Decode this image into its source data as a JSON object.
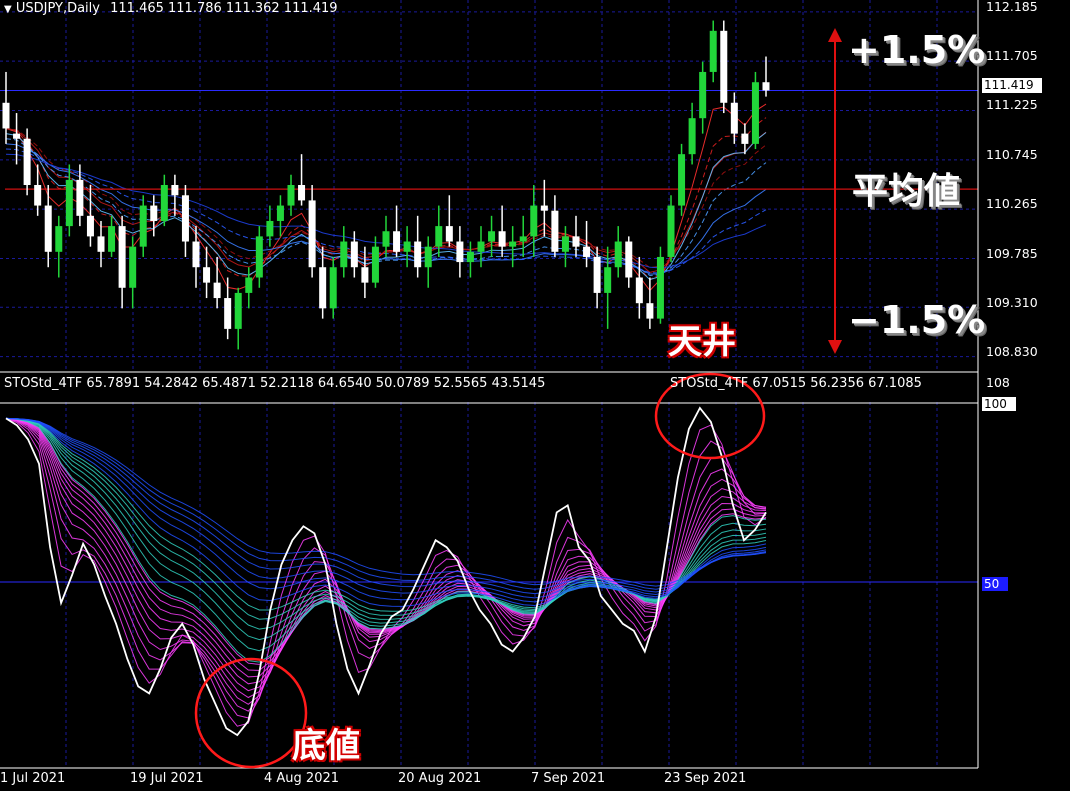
{
  "header": {
    "symbol_label": "USDJPY,Daily",
    "ohlc": "111.465 111.786 111.362 111.419"
  },
  "indicator": {
    "label": "STOStd_4TF 65.7891 54.2842 65.4871 52.2118 64.6540 50.0789 52.5565 43.5145",
    "label2": "STOStd_4TF 67.0515 56.2356 67.1085",
    "scale_top": "108",
    "level_100": "100",
    "level_50": "50"
  },
  "price_scale": [
    "112.185",
    "111.705",
    "111.225",
    "110.745",
    "110.265",
    "109.785",
    "109.310",
    "108.830"
  ],
  "current_price": "111.419",
  "annotations": {
    "plus": "+1.5%",
    "mean": "平均値",
    "minus": "−1.5%",
    "top": "天井",
    "bottom": "底値"
  },
  "colors": {
    "bull": "#22d63a",
    "bear": "#ffffff",
    "grid": "#1a1a9c",
    "mean_line": "#d01010",
    "stoch_main": "#ffffff",
    "stoch_fast": "#ff40ff",
    "stoch_mid": "#30d0c0",
    "stoch_slow": "#2050ff",
    "circle": "#ff1a1a"
  },
  "chart_data": {
    "type": "line",
    "x_labels": [
      "1 Jul 2021",
      "19 Jul 2021",
      "4 Aug 2021",
      "20 Aug 2021",
      "7 Sep 2021",
      "23 Sep 2021"
    ],
    "price_ylim": [
      108.7,
      112.3
    ],
    "mean_price": 110.46,
    "candles": [
      {
        "o": 111.3,
        "h": 111.6,
        "l": 110.9,
        "c": 111.05
      },
      {
        "o": 111.0,
        "h": 111.2,
        "l": 110.7,
        "c": 110.95
      },
      {
        "o": 110.95,
        "h": 111.05,
        "l": 110.4,
        "c": 110.5
      },
      {
        "o": 110.5,
        "h": 110.7,
        "l": 110.2,
        "c": 110.3
      },
      {
        "o": 110.3,
        "h": 110.5,
        "l": 109.7,
        "c": 109.85
      },
      {
        "o": 109.85,
        "h": 110.2,
        "l": 109.6,
        "c": 110.1
      },
      {
        "o": 110.1,
        "h": 110.7,
        "l": 110.0,
        "c": 110.55
      },
      {
        "o": 110.55,
        "h": 110.7,
        "l": 110.1,
        "c": 110.2
      },
      {
        "o": 110.2,
        "h": 110.5,
        "l": 109.9,
        "c": 110.0
      },
      {
        "o": 110.0,
        "h": 110.15,
        "l": 109.7,
        "c": 109.85
      },
      {
        "o": 109.85,
        "h": 110.2,
        "l": 109.8,
        "c": 110.1
      },
      {
        "o": 110.1,
        "h": 110.2,
        "l": 109.3,
        "c": 109.5
      },
      {
        "o": 109.5,
        "h": 110.0,
        "l": 109.3,
        "c": 109.9
      },
      {
        "o": 109.9,
        "h": 110.4,
        "l": 109.8,
        "c": 110.3
      },
      {
        "o": 110.3,
        "h": 110.4,
        "l": 110.0,
        "c": 110.15
      },
      {
        "o": 110.15,
        "h": 110.6,
        "l": 110.1,
        "c": 110.5
      },
      {
        "o": 110.5,
        "h": 110.6,
        "l": 110.2,
        "c": 110.4
      },
      {
        "o": 110.4,
        "h": 110.5,
        "l": 109.8,
        "c": 109.95
      },
      {
        "o": 109.95,
        "h": 110.1,
        "l": 109.5,
        "c": 109.7
      },
      {
        "o": 109.7,
        "h": 109.9,
        "l": 109.4,
        "c": 109.55
      },
      {
        "o": 109.55,
        "h": 109.8,
        "l": 109.3,
        "c": 109.4
      },
      {
        "o": 109.4,
        "h": 109.6,
        "l": 109.0,
        "c": 109.1
      },
      {
        "o": 109.1,
        "h": 109.5,
        "l": 108.9,
        "c": 109.45
      },
      {
        "o": 109.45,
        "h": 109.7,
        "l": 109.3,
        "c": 109.6
      },
      {
        "o": 109.6,
        "h": 110.1,
        "l": 109.5,
        "c": 110.0
      },
      {
        "o": 110.0,
        "h": 110.3,
        "l": 109.9,
        "c": 110.15
      },
      {
        "o": 110.15,
        "h": 110.4,
        "l": 110.0,
        "c": 110.3
      },
      {
        "o": 110.3,
        "h": 110.6,
        "l": 110.2,
        "c": 110.5
      },
      {
        "o": 110.5,
        "h": 110.8,
        "l": 110.3,
        "c": 110.35
      },
      {
        "o": 110.35,
        "h": 110.5,
        "l": 109.6,
        "c": 109.7
      },
      {
        "o": 109.7,
        "h": 109.9,
        "l": 109.2,
        "c": 109.3
      },
      {
        "o": 109.3,
        "h": 109.8,
        "l": 109.2,
        "c": 109.7
      },
      {
        "o": 109.7,
        "h": 110.1,
        "l": 109.6,
        "c": 109.95
      },
      {
        "o": 109.95,
        "h": 110.05,
        "l": 109.6,
        "c": 109.7
      },
      {
        "o": 109.7,
        "h": 109.9,
        "l": 109.4,
        "c": 109.55
      },
      {
        "o": 109.55,
        "h": 110.0,
        "l": 109.5,
        "c": 109.9
      },
      {
        "o": 109.9,
        "h": 110.2,
        "l": 109.8,
        "c": 110.05
      },
      {
        "o": 110.05,
        "h": 110.3,
        "l": 109.8,
        "c": 109.85
      },
      {
        "o": 109.85,
        "h": 110.1,
        "l": 109.7,
        "c": 109.95
      },
      {
        "o": 109.95,
        "h": 110.2,
        "l": 109.6,
        "c": 109.7
      },
      {
        "o": 109.7,
        "h": 110.0,
        "l": 109.5,
        "c": 109.9
      },
      {
        "o": 109.9,
        "h": 110.3,
        "l": 109.8,
        "c": 110.1
      },
      {
        "o": 110.1,
        "h": 110.4,
        "l": 109.9,
        "c": 109.95
      },
      {
        "o": 109.95,
        "h": 110.1,
        "l": 109.6,
        "c": 109.75
      },
      {
        "o": 109.75,
        "h": 109.95,
        "l": 109.6,
        "c": 109.85
      },
      {
        "o": 109.85,
        "h": 110.1,
        "l": 109.7,
        "c": 109.95
      },
      {
        "o": 109.95,
        "h": 110.2,
        "l": 109.8,
        "c": 110.05
      },
      {
        "o": 110.05,
        "h": 110.3,
        "l": 109.8,
        "c": 109.9
      },
      {
        "o": 109.9,
        "h": 110.1,
        "l": 109.7,
        "c": 109.95
      },
      {
        "o": 109.95,
        "h": 110.2,
        "l": 109.8,
        "c": 110.0
      },
      {
        "o": 110.0,
        "h": 110.5,
        "l": 109.8,
        "c": 110.3
      },
      {
        "o": 110.3,
        "h": 110.55,
        "l": 110.0,
        "c": 110.25
      },
      {
        "o": 110.25,
        "h": 110.4,
        "l": 109.8,
        "c": 109.85
      },
      {
        "o": 109.85,
        "h": 110.1,
        "l": 109.7,
        "c": 110.0
      },
      {
        "o": 110.0,
        "h": 110.2,
        "l": 109.8,
        "c": 109.9
      },
      {
        "o": 109.9,
        "h": 110.15,
        "l": 109.7,
        "c": 109.8
      },
      {
        "o": 109.8,
        "h": 109.9,
        "l": 109.3,
        "c": 109.45
      },
      {
        "o": 109.45,
        "h": 109.9,
        "l": 109.1,
        "c": 109.7
      },
      {
        "o": 109.7,
        "h": 110.1,
        "l": 109.6,
        "c": 109.95
      },
      {
        "o": 109.95,
        "h": 110.0,
        "l": 109.5,
        "c": 109.6
      },
      {
        "o": 109.6,
        "h": 109.8,
        "l": 109.2,
        "c": 109.35
      },
      {
        "o": 109.35,
        "h": 109.6,
        "l": 109.1,
        "c": 109.2
      },
      {
        "o": 109.2,
        "h": 109.9,
        "l": 109.15,
        "c": 109.8
      },
      {
        "o": 109.8,
        "h": 110.4,
        "l": 109.75,
        "c": 110.3
      },
      {
        "o": 110.3,
        "h": 110.9,
        "l": 110.2,
        "c": 110.8
      },
      {
        "o": 110.8,
        "h": 111.3,
        "l": 110.7,
        "c": 111.15
      },
      {
        "o": 111.15,
        "h": 111.7,
        "l": 111.0,
        "c": 111.6
      },
      {
        "o": 111.6,
        "h": 112.1,
        "l": 111.5,
        "c": 112.0
      },
      {
        "o": 112.0,
        "h": 112.1,
        "l": 111.2,
        "c": 111.3
      },
      {
        "o": 111.3,
        "h": 111.4,
        "l": 110.9,
        "c": 111.0
      },
      {
        "o": 111.0,
        "h": 111.1,
        "l": 110.8,
        "c": 110.9
      },
      {
        "o": 110.9,
        "h": 111.6,
        "l": 110.85,
        "c": 111.5
      },
      {
        "o": 111.5,
        "h": 111.75,
        "l": 111.36,
        "c": 111.42
      }
    ],
    "stoch_main": [
      97,
      95,
      91,
      84,
      60,
      44,
      52,
      61,
      55,
      46,
      38,
      28,
      20,
      18,
      25,
      34,
      38,
      32,
      22,
      15,
      8,
      6,
      10,
      24,
      42,
      55,
      62,
      66,
      64,
      55,
      38,
      25,
      18,
      26,
      35,
      40,
      42,
      48,
      55,
      62,
      60,
      56,
      48,
      42,
      38,
      32,
      30,
      34,
      40,
      55,
      70,
      72,
      60,
      56,
      46,
      42,
      38,
      36,
      30,
      40,
      60,
      80,
      94,
      100,
      96,
      86,
      72,
      62,
      65,
      70
    ]
  }
}
